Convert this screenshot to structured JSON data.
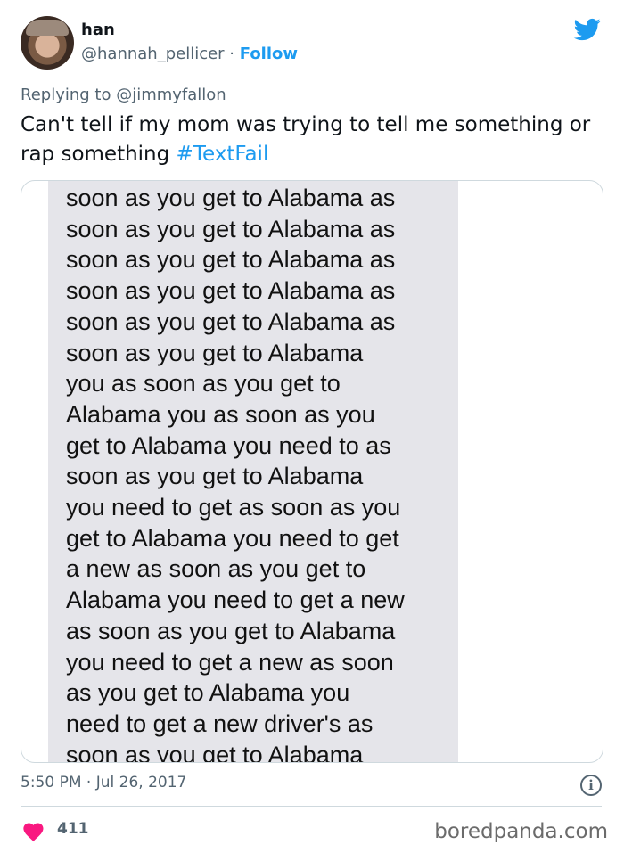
{
  "author": {
    "display_name": "han",
    "handle": "@hannah_pellicer",
    "separator": " · ",
    "follow_label": "Follow"
  },
  "reply_context": "Replying to @jimmyfallon",
  "tweet": {
    "text": "Can't tell if my mom was trying to tell me something or rap something ",
    "hashtag": "#TextFail"
  },
  "media": {
    "message_text": "soon as you get to Alabama as\nsoon as you get to Alabama as\nsoon as you get to Alabama as\nsoon as you get to Alabama as\nsoon as you get to Alabama as\nsoon as you get to Alabama\nyou as soon as you get to\nAlabama you as soon as you\nget to Alabama you need to as\nsoon as you get to Alabama\nyou need to get as soon as you\nget to Alabama you need to get\na new as soon as you get to\nAlabama you need to get a new\nas soon as you get to Alabama\nyou need to get a new as soon\nas you get to Alabama you\nneed to get a new driver's as\nsoon as you get to Alabama"
  },
  "timestamp": "5:50 PM · Jul 26, 2017",
  "info_icon_glyph": "i",
  "like_count": "411",
  "watermark": "boredpanda.com",
  "colors": {
    "twitter_blue": "#1d9bf0",
    "heart_pink": "#f91880",
    "secondary_text": "#536471",
    "bubble_gray": "#e5e5ea"
  },
  "icons": [
    "twitter-bird-icon",
    "heart-icon",
    "info-icon"
  ]
}
